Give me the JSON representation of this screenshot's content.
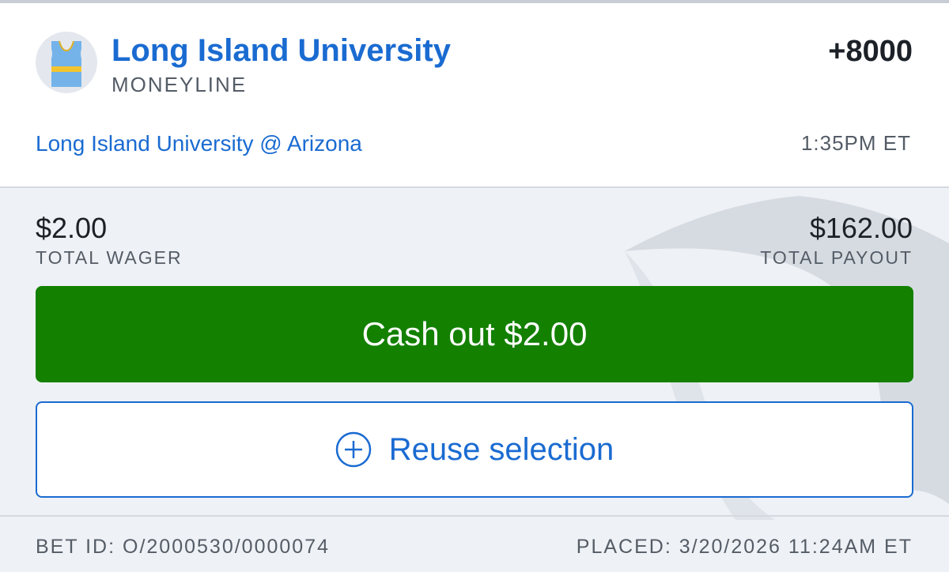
{
  "bet": {
    "team_name": "Long Island University",
    "bet_type": "MONEYLINE",
    "odds": "+8000",
    "matchup": "Long Island University @ Arizona",
    "game_time": "1:35PM ET",
    "team_icon": "jersey-icon"
  },
  "wager": {
    "amount": "$2.00",
    "label": "TOTAL WAGER"
  },
  "payout": {
    "amount": "$162.00",
    "label": "TOTAL PAYOUT"
  },
  "actions": {
    "cashout_label": "Cash out $2.00",
    "reuse_label": "Reuse selection",
    "reuse_icon": "plus-circle-icon"
  },
  "footer": {
    "bet_id": "BET ID: O/2000530/0000074",
    "placed": "PLACED: 3/20/2026 11:24AM ET"
  },
  "colors": {
    "accent_blue": "#1a6bd1",
    "cashout_green": "#138000",
    "jersey_blue": "#74b3ea",
    "jersey_stripe": "#f4c430"
  }
}
